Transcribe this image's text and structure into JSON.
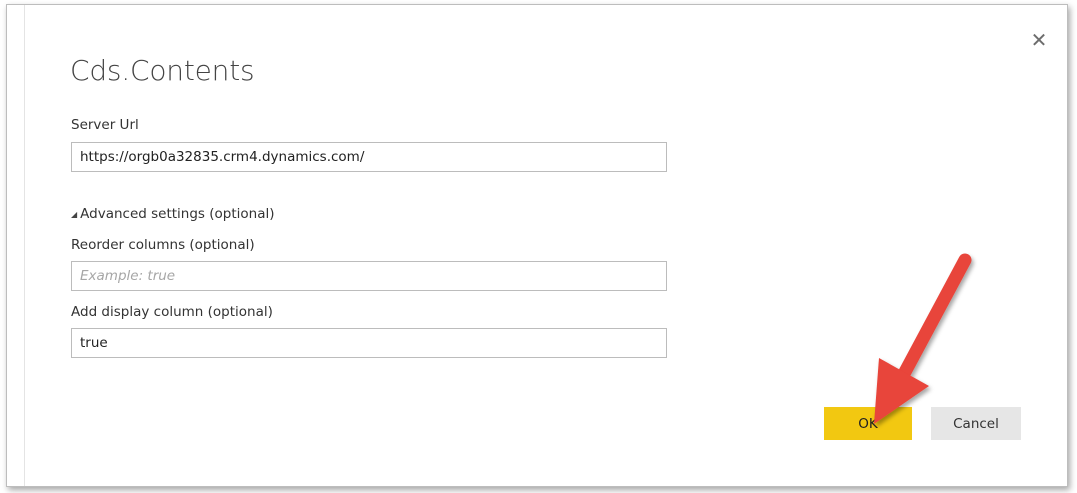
{
  "dialog": {
    "title": "Cds.Contents",
    "close_icon": "close-icon"
  },
  "server_url": {
    "label": "Server Url",
    "value": "https://orgb0a32835.crm4.dynamics.com/"
  },
  "advanced": {
    "toggle_label": "Advanced settings (optional)",
    "toggle_icon": "triangle-collapse-icon",
    "reorder_columns": {
      "label": "Reorder columns (optional)",
      "value": "",
      "placeholder": "Example: true"
    },
    "add_display_column": {
      "label": "Add display column (optional)",
      "value": "true"
    }
  },
  "buttons": {
    "ok_label": "OK",
    "cancel_label": "Cancel"
  },
  "colors": {
    "ok_button": "#f2c811",
    "cancel_button": "#e6e6e6",
    "annotation_arrow": "#e8443a"
  },
  "annotation": {
    "icon": "red-arrow-pointer-icon"
  }
}
